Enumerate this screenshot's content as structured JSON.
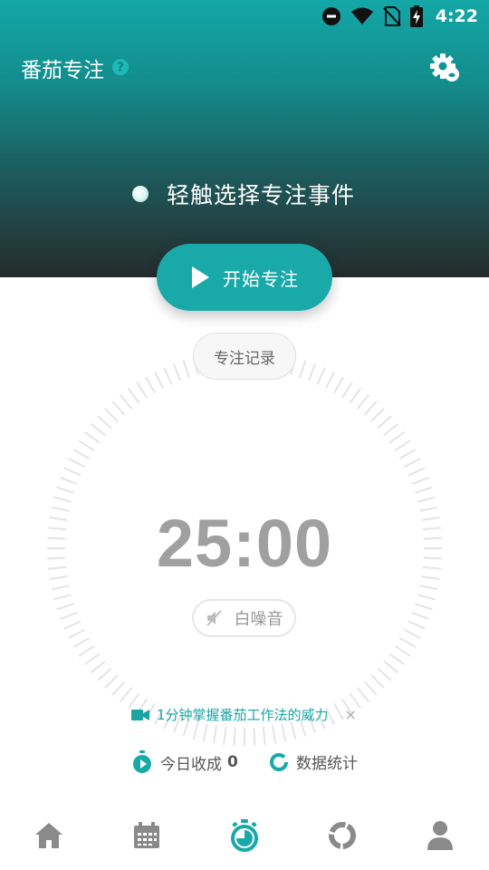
{
  "status_bar": {
    "time": "4:22"
  },
  "header": {
    "title": "番茄专注"
  },
  "focus_event": {
    "prompt": "轻触选择专注事件"
  },
  "start_button": {
    "label": "开始专注"
  },
  "records_button": {
    "label": "专注记录"
  },
  "timer": {
    "display": "25:00"
  },
  "white_noise": {
    "label": "白噪音"
  },
  "tip": {
    "text": "1分钟掌握番茄工作法的威力",
    "close": "×"
  },
  "stats": {
    "today_label": "今日收成",
    "today_count": "0",
    "data_label": "数据统计"
  },
  "colors": {
    "accent": "#1aa9a9",
    "header_top": "#14a7a7",
    "header_bottom": "#252b2c",
    "inactive": "#8a8a8a"
  },
  "bottom_nav": {
    "items": [
      {
        "icon": "home-icon",
        "active": false
      },
      {
        "icon": "calendar-icon",
        "active": false
      },
      {
        "icon": "stopwatch-icon",
        "active": true
      },
      {
        "icon": "ring-chart-icon",
        "active": false
      },
      {
        "icon": "user-icon",
        "active": false
      }
    ]
  }
}
